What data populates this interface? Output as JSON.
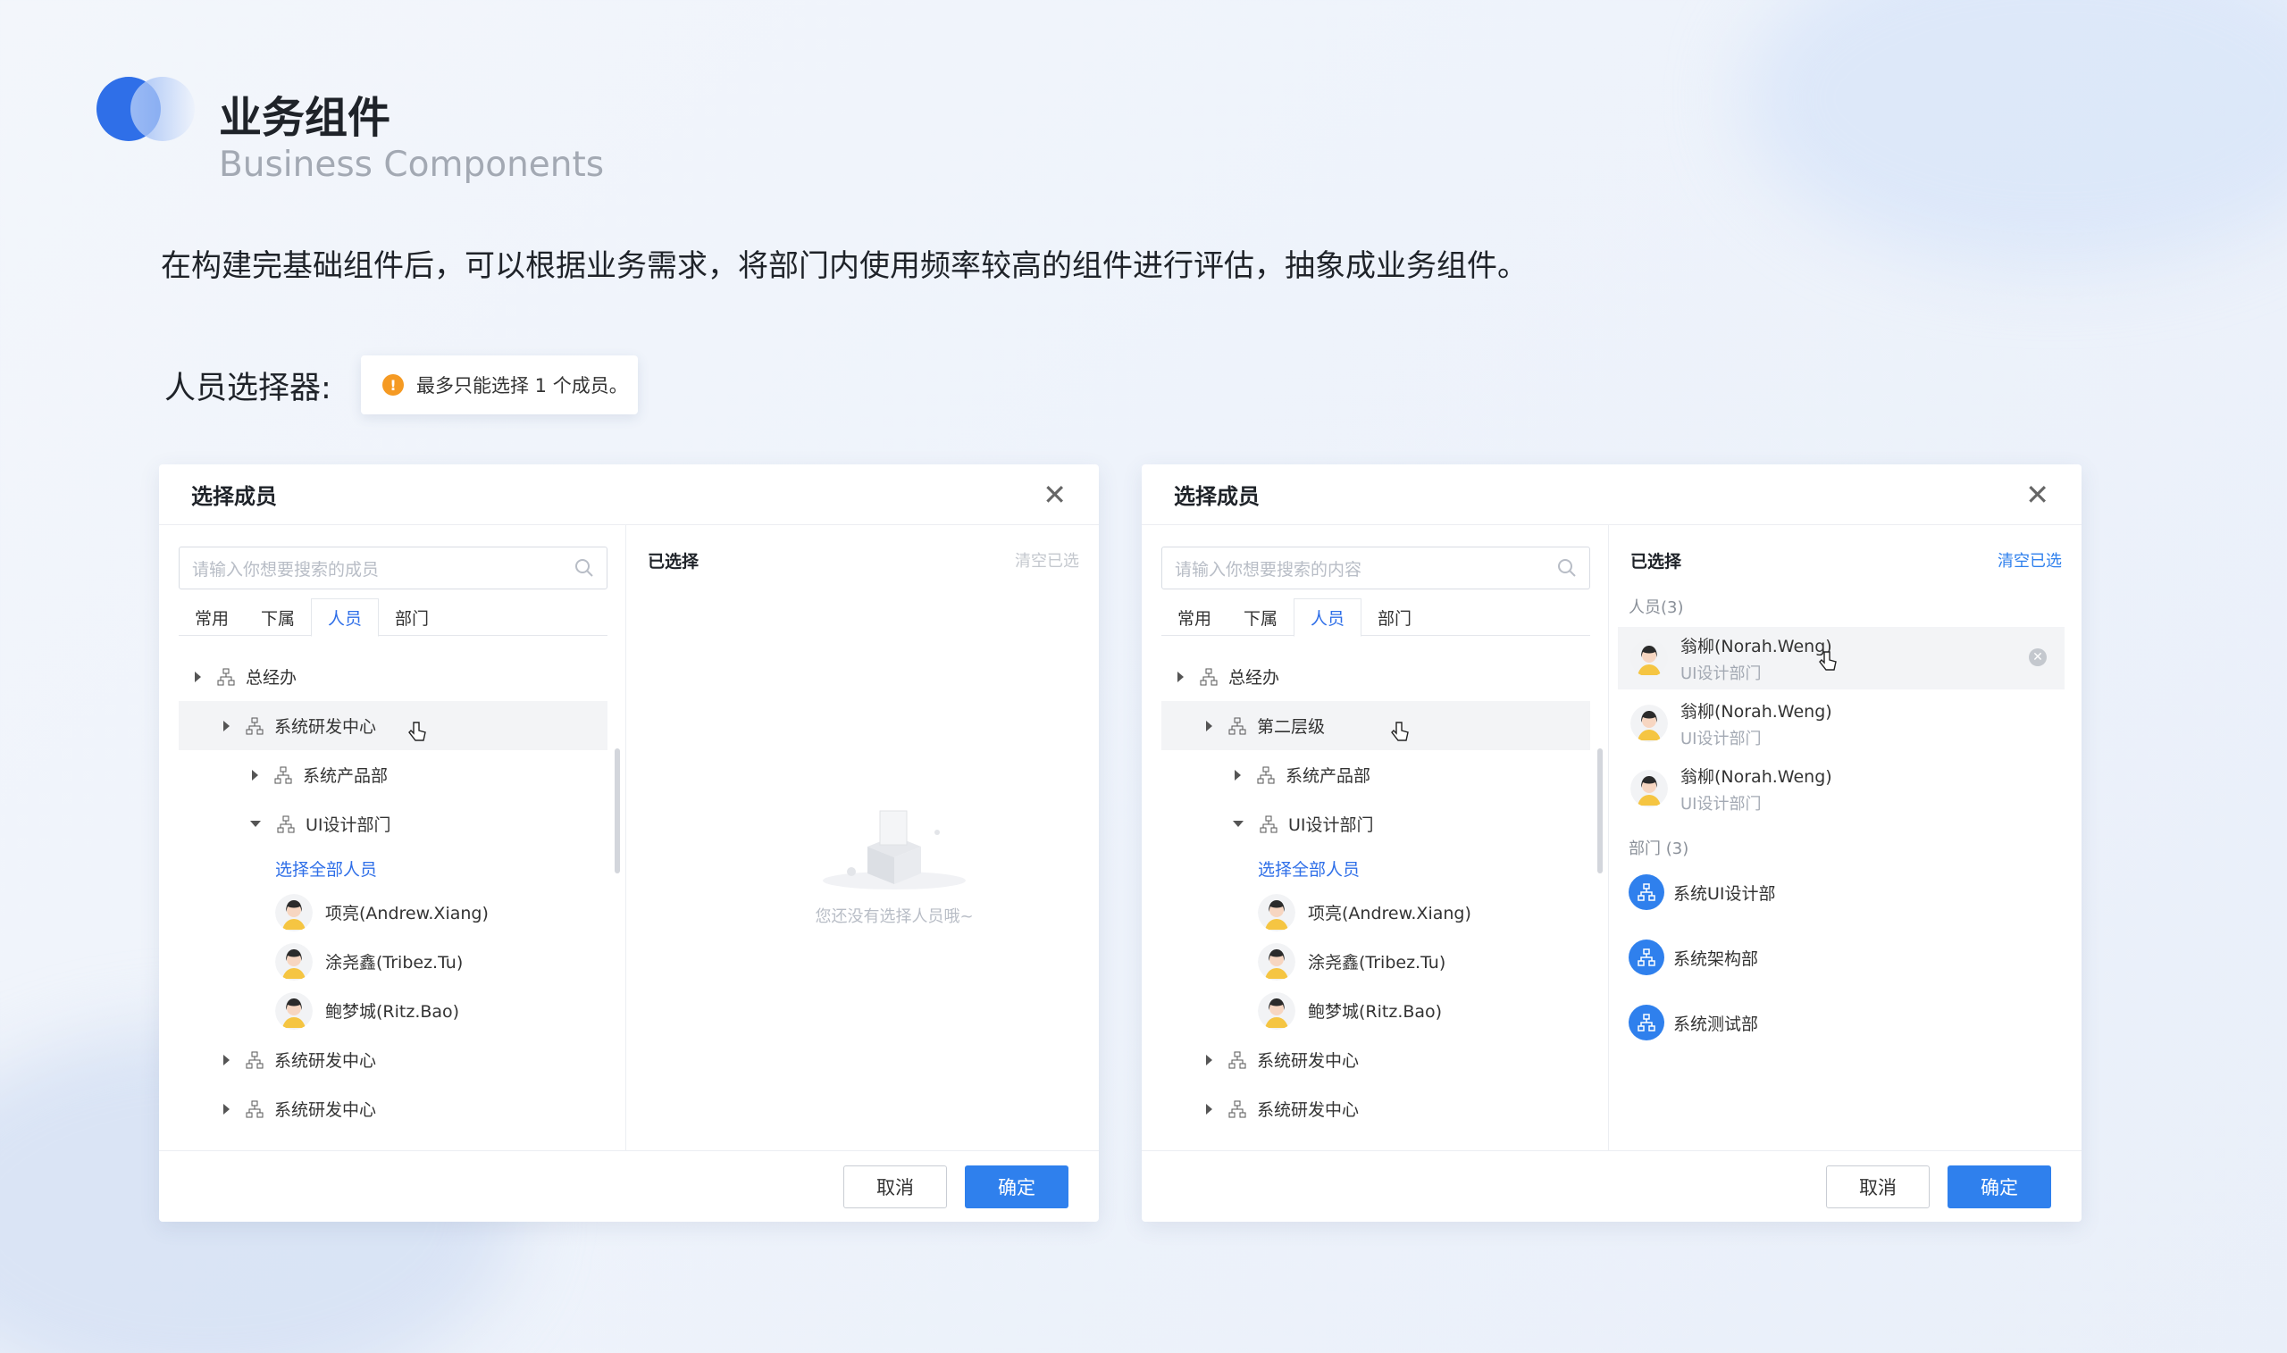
{
  "header": {
    "title": "业务组件",
    "subtitle": "Business Components",
    "description": "在构建完基础组件后，可以根据业务需求，将部门内使用频率较高的组件进行评估，抽象成业务组件。"
  },
  "picker_label": "人员选择器:",
  "toast": {
    "text": "最多只能选择 1 个成员。",
    "icon": "warning-icon",
    "color": "#f59a23"
  },
  "accent_color": "#2f80ed",
  "dialog_left": {
    "title": "选择成员",
    "search_placeholder": "请输入你想要搜索的成员",
    "tabs": [
      "常用",
      "下属",
      "人员",
      "部门"
    ],
    "active_tab": "人员",
    "tree": {
      "n1": "总经办",
      "n2": "系统研发中心",
      "n3": "系统产品部",
      "n4": "UI设计部门",
      "select_all": "选择全部人员",
      "p1": "项亮(Andrew.Xiang)",
      "p2": "涂尧鑫(Tribez.Tu)",
      "p3": "鲍梦城(Ritz.Bao)",
      "n5": "系统研发中心",
      "n6": "系统研发中心"
    },
    "selected_title": "已选择",
    "clear": "清空已选",
    "empty_text": "您还没有选择人员哦~",
    "cancel": "取消",
    "ok": "确定"
  },
  "dialog_right": {
    "title": "选择成员",
    "search_placeholder": "请输入你想要搜索的内容",
    "tabs": [
      "常用",
      "下属",
      "人员",
      "部门"
    ],
    "active_tab": "人员",
    "tree": {
      "n1": "总经办",
      "n2": "第二层级",
      "n3": "系统产品部",
      "n4": "UI设计部门",
      "select_all": "选择全部人员",
      "p1": "项亮(Andrew.Xiang)",
      "p2": "涂尧鑫(Tribez.Tu)",
      "p3": "鲍梦城(Ritz.Bao)",
      "n5": "系统研发中心",
      "n6": "系统研发中心"
    },
    "selected_title": "已选择",
    "clear": "清空已选",
    "people_header": "人员(3)",
    "people": [
      {
        "name": "翁柳(Norah.Weng)",
        "dept": "UI设计部门"
      },
      {
        "name": "翁柳(Norah.Weng)",
        "dept": "UI设计部门"
      },
      {
        "name": "翁柳(Norah.Weng)",
        "dept": "UI设计部门"
      }
    ],
    "dept_header": "部门 (3)",
    "depts": [
      "系统UI设计部",
      "系统架构部",
      "系统测试部"
    ],
    "cancel": "取消",
    "ok": "确定"
  }
}
